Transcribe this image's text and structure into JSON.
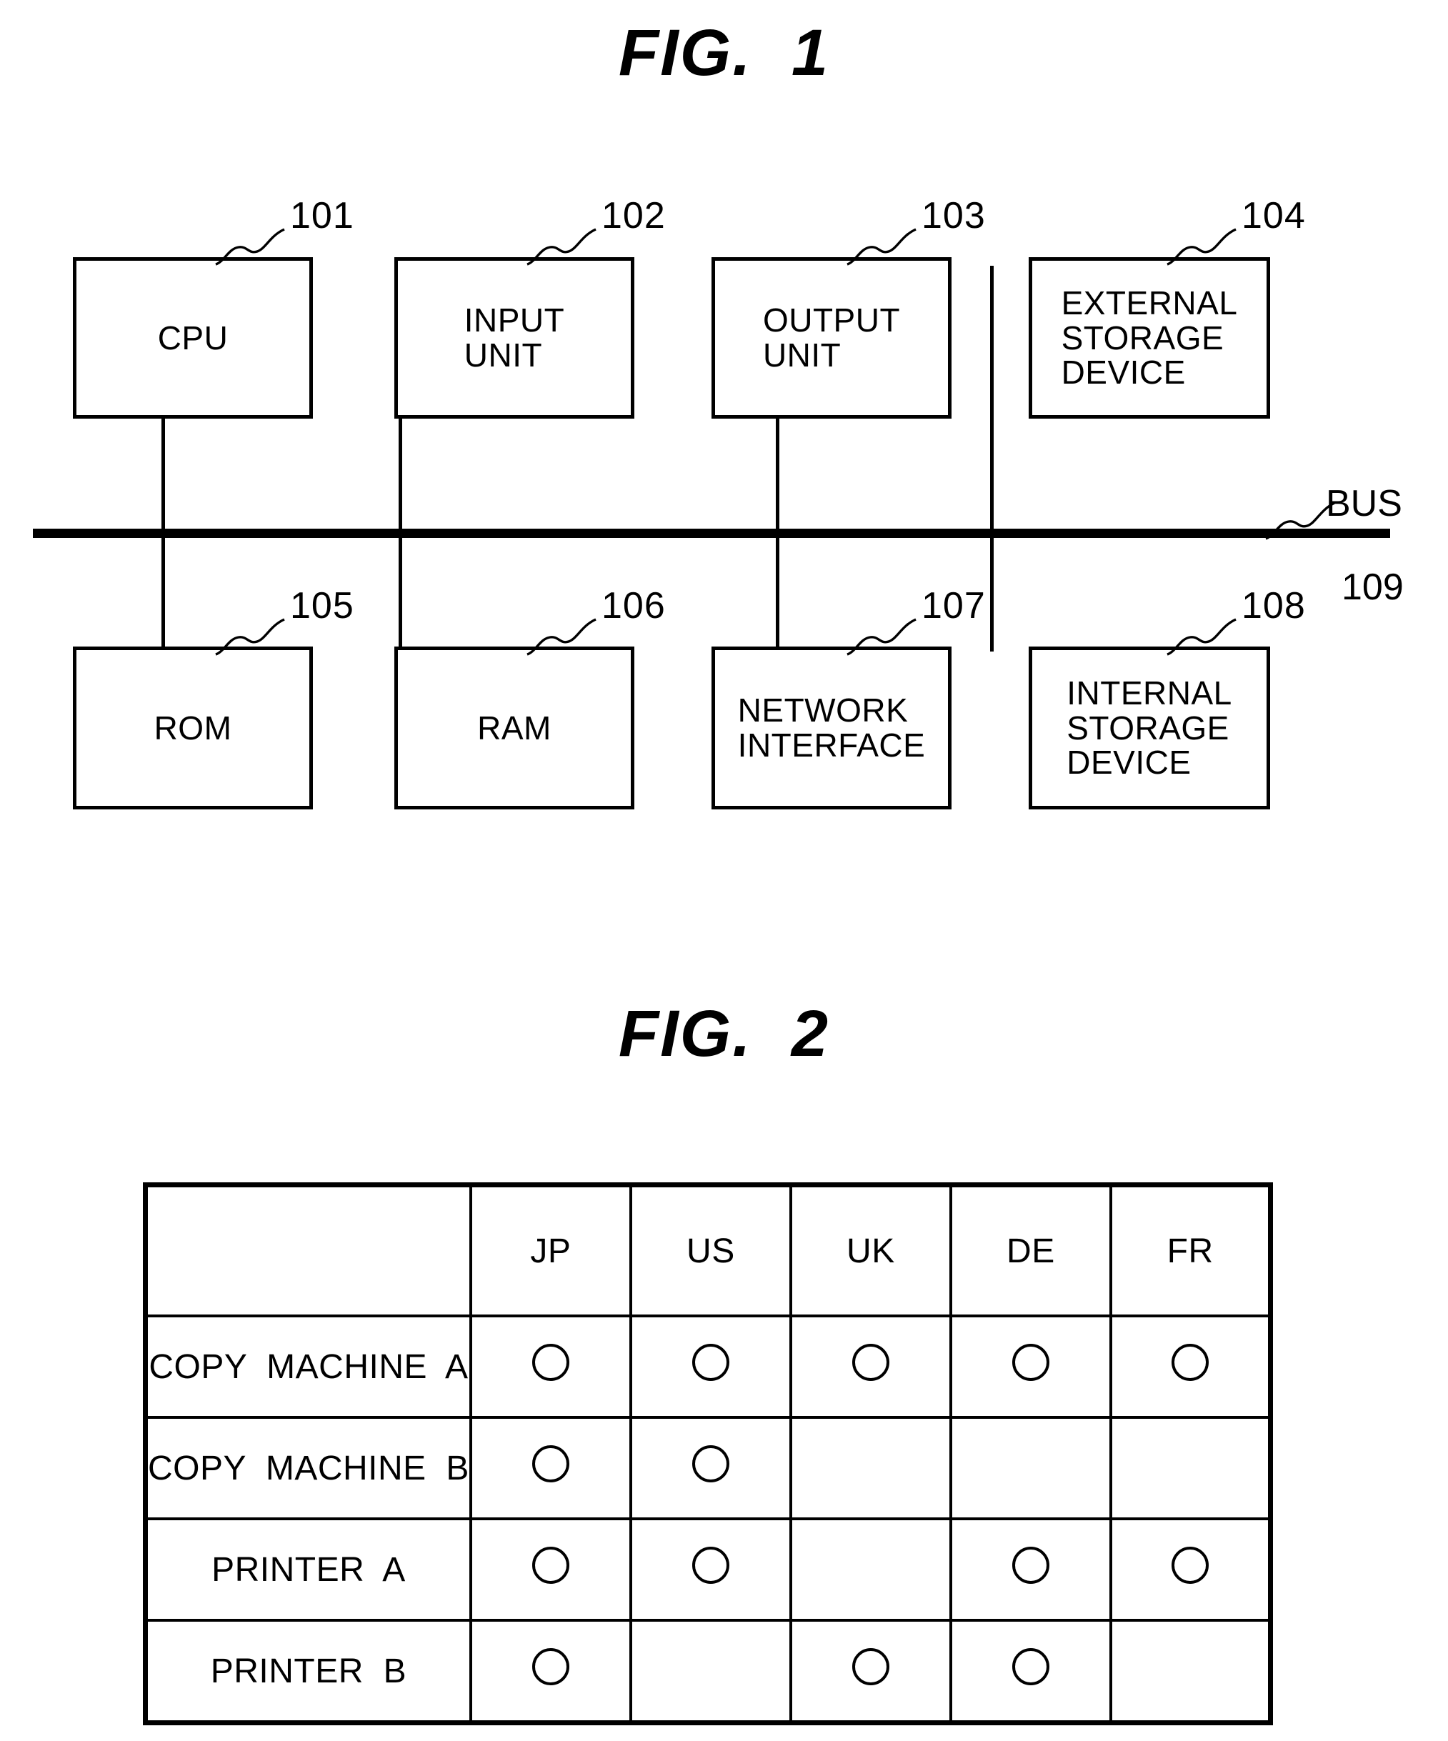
{
  "figures": [
    {
      "id": "fig1",
      "title": "FIG.  1",
      "bus": {
        "label_line1": "BUS",
        "label_line2": "109",
        "ref": "109",
        "name": "BUS"
      },
      "blocks": [
        {
          "ref": "101",
          "label": "CPU",
          "row": "top"
        },
        {
          "ref": "102",
          "label": "INPUT\nUNIT",
          "row": "top"
        },
        {
          "ref": "103",
          "label": "OUTPUT\nUNIT",
          "row": "top"
        },
        {
          "ref": "104",
          "label": "EXTERNAL\nSTORAGE\nDEVICE",
          "row": "top"
        },
        {
          "ref": "105",
          "label": "ROM",
          "row": "bottom"
        },
        {
          "ref": "106",
          "label": "RAM",
          "row": "bottom"
        },
        {
          "ref": "107",
          "label": "NETWORK\nINTERFACE",
          "row": "bottom"
        },
        {
          "ref": "108",
          "label": "INTERNAL\nSTORAGE\nDEVICE",
          "row": "bottom"
        }
      ]
    },
    {
      "id": "fig2",
      "title": "FIG.  2",
      "table": {
        "corner_label": "",
        "columns": [
          "JP",
          "US",
          "UK",
          "DE",
          "FR"
        ],
        "rows": [
          {
            "label": "COPY  MACHINE  A",
            "marks": [
              true,
              true,
              true,
              true,
              true
            ]
          },
          {
            "label": "COPY  MACHINE  B",
            "marks": [
              true,
              true,
              false,
              false,
              false
            ]
          },
          {
            "label": "PRINTER  A",
            "marks": [
              true,
              true,
              false,
              true,
              true
            ]
          },
          {
            "label": "PRINTER  B",
            "marks": [
              true,
              false,
              true,
              true,
              false
            ]
          }
        ],
        "mark_symbol": "circle"
      }
    }
  ],
  "colors": {
    "ink": "#000000",
    "paper": "#ffffff"
  }
}
